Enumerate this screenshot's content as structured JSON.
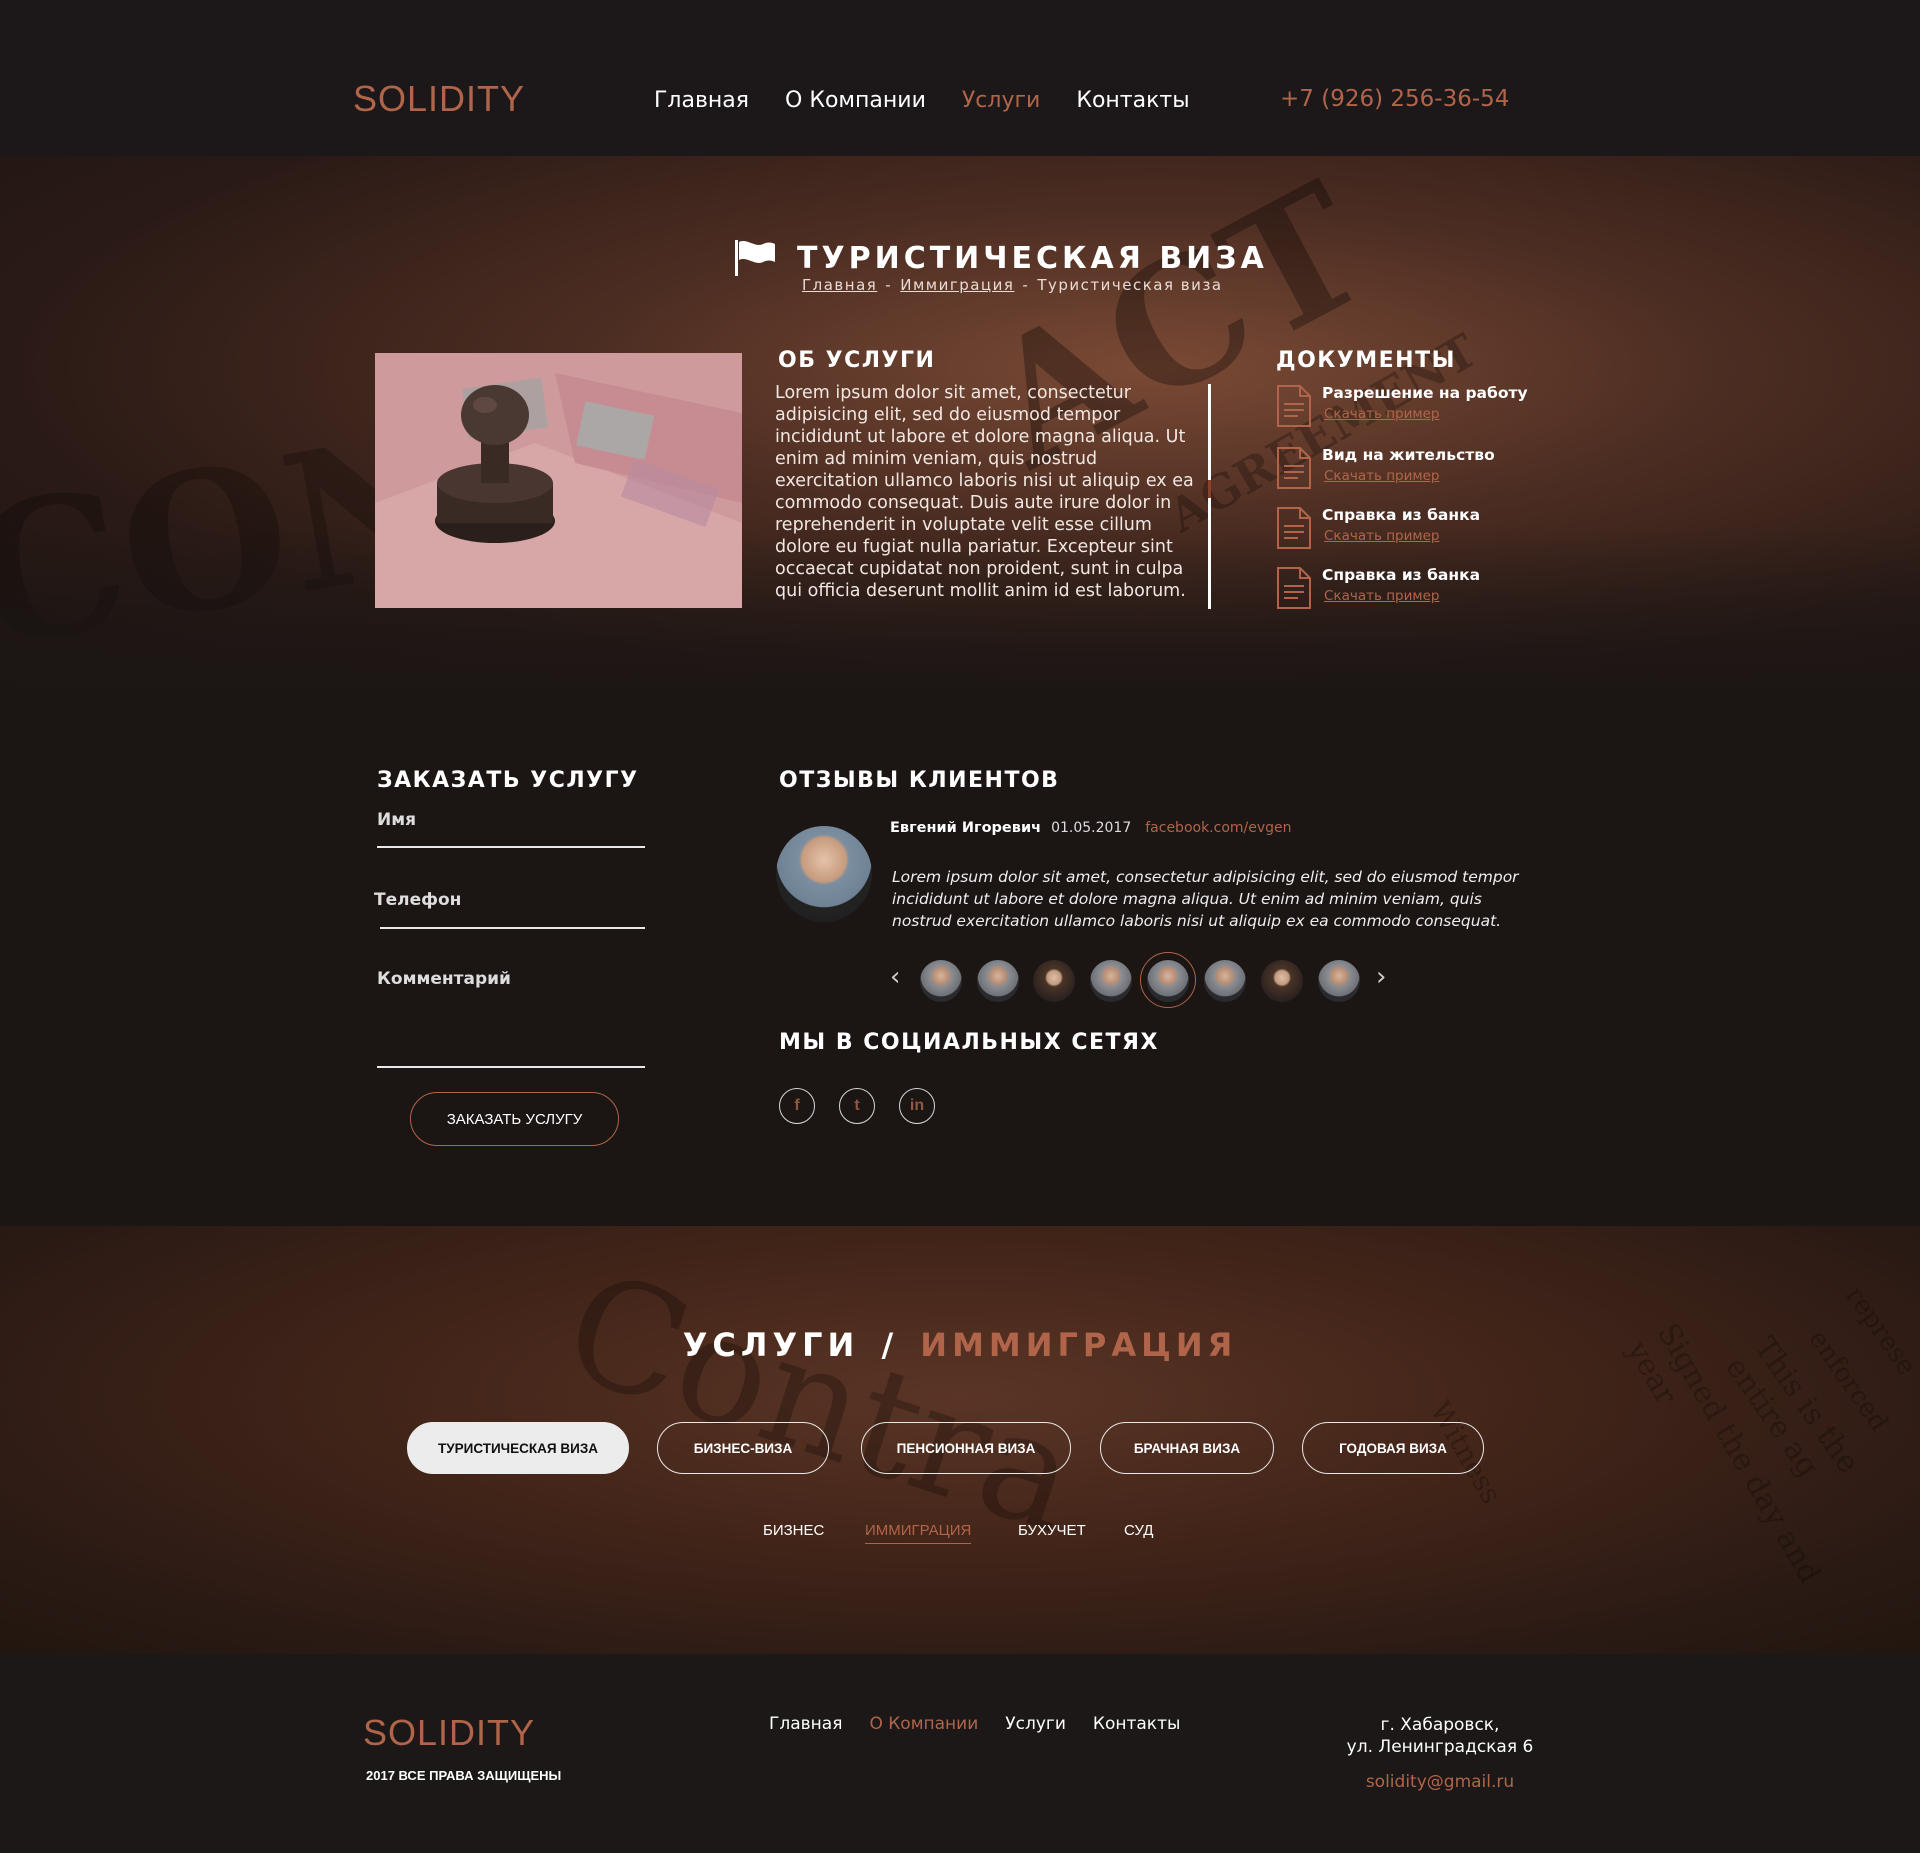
{
  "header": {
    "logo": "SOLIDITY",
    "nav": [
      {
        "label": "Главная",
        "active": false
      },
      {
        "label": "О Компании",
        "active": false
      },
      {
        "label": "Услуги",
        "active": true
      },
      {
        "label": "Контакты",
        "active": false
      }
    ],
    "phone": "+7 (926) 256-36-54"
  },
  "hero": {
    "title": "ТУРИСТИЧЕСКАЯ ВИЗА",
    "breadcrumb": {
      "home": "Главная",
      "sep1": "-",
      "section": "Иммиграция",
      "sep2": "-",
      "current": "Туристическая виза"
    },
    "decor_text": [
      "ACT",
      "CONT",
      "AGREEMENT"
    ],
    "about": {
      "heading": "ОБ УСЛУГИ",
      "text": "Lorem ipsum dolor sit amet, consectetur adipisicing elit, sed do eiusmod tempor incididunt ut labore et dolore magna aliqua. Ut enim ad minim veniam, quis nostrud exercitation ullamco laboris nisi ut aliquip ex ea commodo consequat. Duis aute irure dolor in reprehenderit in voluptate velit esse cillum dolore eu fugiat nulla pariatur. Excepteur sint occaecat cupidatat non proident, sunt in culpa qui officia deserunt mollit anim id est laborum."
    },
    "documents": {
      "heading": "ДОКУМЕНТЫ",
      "items": [
        {
          "title": "Разрешение на работу",
          "link": "Скачать пример"
        },
        {
          "title": "Вид на жительство",
          "link": "Скачать пример"
        },
        {
          "title": "Справка из банка",
          "link": "Скачать пример"
        },
        {
          "title": "Справка из банка",
          "link": "Скачать пример"
        }
      ]
    }
  },
  "order_form": {
    "heading": "ЗАКАЗАТЬ УСЛУГУ",
    "name_label": "Имя",
    "phone_label": "Телефон",
    "comment_label": "Комментарий",
    "submit_label": "ЗАКАЗАТЬ УСЛУГУ"
  },
  "reviews": {
    "heading": "ОТЗЫВЫ КЛИЕНТОВ",
    "name": "Евгений Игоревич",
    "date": "01.05.2017",
    "link": "facebook.com/evgen",
    "text": "Lorem ipsum dolor sit amet, consectetur adipisicing elit, sed do eiusmod tempor incididunt ut labore et dolore magna aliqua. Ut enim ad minim veniam, quis nostrud exercitation ullamco laboris nisi ut aliquip ex ea commodo consequat.",
    "prev_icon": "‹",
    "next_icon": "›",
    "thumbs_count": 8,
    "active_thumb": 5
  },
  "social": {
    "heading": "МЫ В СОЦИАЛЬНЫХ СЕТЯХ",
    "items": [
      {
        "icon": "facebook-icon",
        "glyph": "f"
      },
      {
        "icon": "twitter-icon",
        "glyph": "t"
      },
      {
        "icon": "linkedin-icon",
        "glyph": "in"
      }
    ]
  },
  "services": {
    "title_main": "УСЛУГИ",
    "title_slash": "/",
    "title_accent": "ИММИГРАЦИЯ",
    "pills": [
      {
        "label": "ТУРИСТИЧЕСКАЯ ВИЗА",
        "active": true
      },
      {
        "label": "БИЗНЕС-ВИЗА",
        "active": false
      },
      {
        "label": "ПЕНСИОННАЯ ВИЗА",
        "active": false
      },
      {
        "label": "БРАЧНАЯ ВИЗА",
        "active": false
      },
      {
        "label": "ГОДОВАЯ ВИЗА",
        "active": false
      }
    ],
    "categories": [
      {
        "label": "БИЗНЕС",
        "active": false
      },
      {
        "label": "ИММИГРАЦИЯ",
        "active": true
      },
      {
        "label": "БУХУЧЕТ",
        "active": false
      },
      {
        "label": "СУД",
        "active": false
      }
    ],
    "decor_text": [
      "Contra",
      "This is the entire ag",
      "Signed the day and year",
      "Witness",
      "represe",
      "enforced"
    ]
  },
  "footer": {
    "logo": "SOLIDITY",
    "copyright": "2017 ВСЕ ПРАВА ЗАЩИЩЕНЫ",
    "nav": [
      {
        "label": "Главная",
        "active": false
      },
      {
        "label": "О Компании",
        "active": true
      },
      {
        "label": "Услуги",
        "active": false
      },
      {
        "label": "Контакты",
        "active": false
      }
    ],
    "address_line1": "г. Хабаровск,",
    "address_line2": "ул. Ленинградская 6",
    "email": "solidity@gmail.ru"
  },
  "colors": {
    "accent": "#b0654a",
    "background": "#1b1615"
  }
}
